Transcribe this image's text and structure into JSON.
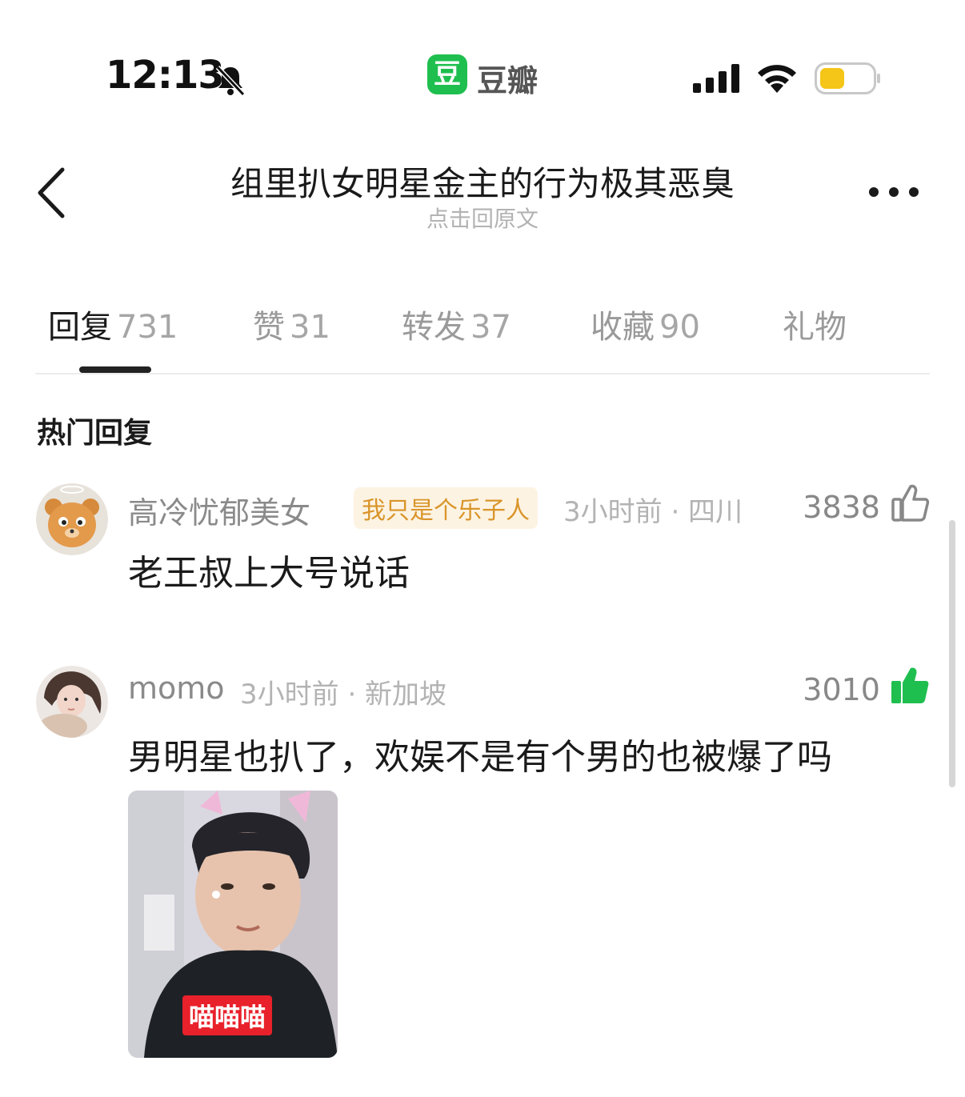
{
  "status_bar": {
    "time": "12:13",
    "app_badge": "豆",
    "app_name": "豆瓣",
    "battery_color": "#f5c518"
  },
  "header": {
    "title": "组里扒女明星金主的行为极其恶臭",
    "subtitle": "点击回原文",
    "back_icon": "chevron-left-icon",
    "more_icon": "more-dots-icon"
  },
  "tabs": [
    {
      "label": "回复",
      "count": "731",
      "active": true
    },
    {
      "label": "赞",
      "count": "31"
    },
    {
      "label": "转发",
      "count": "37"
    },
    {
      "label": "收藏",
      "count": "90"
    },
    {
      "label": "礼物",
      "count": ""
    }
  ],
  "section_title": "热门回复",
  "comments": [
    {
      "name": "高冷忧郁美女",
      "tag": "我只是个乐子人",
      "meta": "3小时前 · 四川",
      "likes": "3838",
      "liked": false,
      "text": "老王叔上大号说话"
    },
    {
      "name": "momo",
      "tag": "",
      "meta": "3小时前 · 新加坡",
      "likes": "3010",
      "liked": true,
      "like_color": "#1fbf4f",
      "text": "男明星也扒了，欢娱不是有个男的也被爆了吗",
      "image_caption": "喵喵喵"
    }
  ]
}
